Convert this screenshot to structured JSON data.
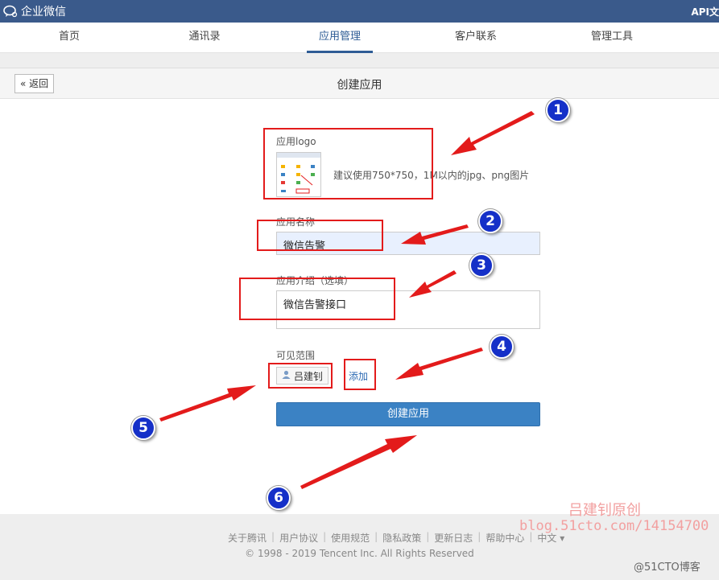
{
  "topbar": {
    "brand": "企业微信",
    "right_link": "API文"
  },
  "nav": {
    "items": [
      "首页",
      "通讯录",
      "应用管理",
      "客户联系",
      "管理工具"
    ],
    "active_index": 2
  },
  "page": {
    "back_label": "返回",
    "title": "创建应用"
  },
  "form": {
    "logo_label": "应用logo",
    "logo_hint": "建议使用750*750，1M以内的jpg、png图片",
    "name_label": "应用名称",
    "name_value": "微信告警",
    "desc_label": "应用介绍（选填）",
    "desc_value": "微信告警接口",
    "scope_label": "可见范围",
    "scope_member": "吕建钊",
    "add_label": "添加",
    "submit_label": "创建应用"
  },
  "annotations": {
    "badges": [
      "1",
      "2",
      "3",
      "4",
      "5",
      "6"
    ],
    "color": "#e31b1b"
  },
  "footer": {
    "links": [
      "关于腾讯",
      "用户协议",
      "使用规范",
      "隐私政策",
      "更新日志",
      "帮助中心",
      "中文 ▾"
    ],
    "copyright": "© 1998 - 2019 Tencent Inc. All Rights Reserved"
  },
  "watermark": {
    "line1": "吕建钊原创",
    "line2": "blog.51cto.com/14154700",
    "line3": "@51CTO博客"
  },
  "colors": {
    "topbar": "#3a5a8b",
    "accent": "#2e5c95",
    "button": "#3b82c4"
  }
}
